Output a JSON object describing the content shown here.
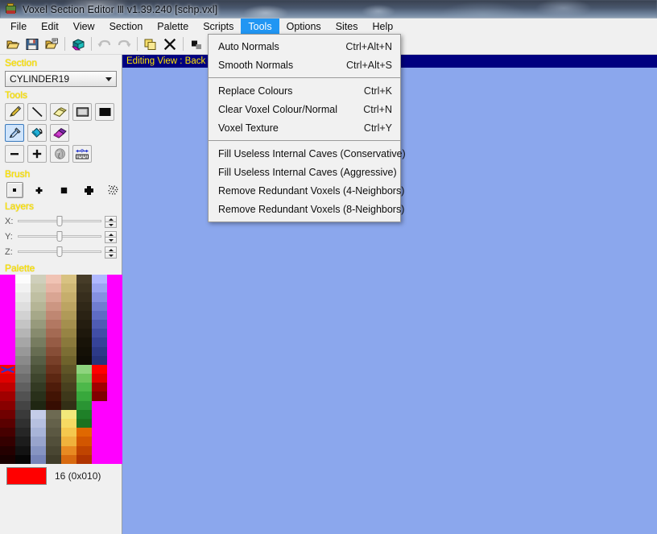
{
  "window": {
    "title": "Voxel Section Editor Ⅲ v1.39.240 [schp.vxl]",
    "icon": "voxel-app-icon"
  },
  "menubar": {
    "items": [
      {
        "label": "File",
        "active": false
      },
      {
        "label": "Edit",
        "active": false
      },
      {
        "label": "View",
        "active": false
      },
      {
        "label": "Section",
        "active": false
      },
      {
        "label": "Palette",
        "active": false
      },
      {
        "label": "Scripts",
        "active": false
      },
      {
        "label": "Tools",
        "active": true
      },
      {
        "label": "Options",
        "active": false
      },
      {
        "label": "Sites",
        "active": false
      },
      {
        "label": "Help",
        "active": false
      }
    ]
  },
  "toolbar": {
    "buttons": [
      {
        "name": "open-icon",
        "tip": "Open"
      },
      {
        "name": "save-icon",
        "tip": "Save"
      },
      {
        "name": "save-as-icon",
        "tip": "Save As"
      },
      {
        "name": "voxel-shape-icon",
        "tip": "Voxel"
      },
      {
        "name": "undo-icon",
        "tip": "Undo",
        "disabled": true
      },
      {
        "name": "redo-icon",
        "tip": "Redo",
        "disabled": true
      },
      {
        "name": "copy-icon",
        "tip": "Copy"
      },
      {
        "name": "delete-icon",
        "tip": "Delete"
      },
      {
        "name": "cube-icon",
        "tip": "Cube"
      }
    ]
  },
  "tools_menu": {
    "open": true,
    "groups": [
      [
        {
          "label": "Auto Normals",
          "accel": "Ctrl+Alt+N"
        },
        {
          "label": "Smooth Normals",
          "accel": "Ctrl+Alt+S"
        }
      ],
      [
        {
          "label": "Replace Colours",
          "accel": "Ctrl+K"
        },
        {
          "label": "Clear Voxel Colour/Normal",
          "accel": "Ctrl+N"
        },
        {
          "label": "Voxel Texture",
          "accel": "Ctrl+Y"
        }
      ],
      [
        {
          "label": "Fill Useless Internal Caves (Conservative)",
          "accel": ""
        },
        {
          "label": "Fill Useless Internal Caves (Aggressive)",
          "accel": ""
        },
        {
          "label": "Remove Redundant Voxels (4-Neighbors)",
          "accel": ""
        },
        {
          "label": "Remove Redundant Voxels (8-Neighbors)",
          "accel": ""
        }
      ]
    ]
  },
  "sidebar": {
    "section": {
      "label": "Section",
      "value": "CYLINDER19"
    },
    "tools": {
      "label": "Tools",
      "items": [
        {
          "name": "pencil-tool-icon",
          "selected": false
        },
        {
          "name": "line-tool-icon",
          "selected": false
        },
        {
          "name": "eraser-tool-icon",
          "selected": false
        },
        {
          "name": "rectangle-outline-tool-icon",
          "selected": false
        },
        {
          "name": "rectangle-filled-tool-icon",
          "selected": false
        },
        {
          "name": "eyedropper-tool-icon",
          "selected": true
        },
        {
          "name": "paint-bucket-tool-icon",
          "selected": false
        },
        {
          "name": "gradient-fill-tool-icon",
          "selected": false
        },
        {
          "name": "decrease-tool-icon",
          "selected": false
        },
        {
          "name": "increase-tool-icon",
          "selected": false
        },
        {
          "name": "smudge-tool-icon",
          "selected": false
        },
        {
          "name": "measure-tool-icon",
          "selected": false
        }
      ]
    },
    "brush": {
      "label": "Brush",
      "items": [
        {
          "name": "brush-dot-icon",
          "selected": true
        },
        {
          "name": "brush-small-plus-icon",
          "selected": false
        },
        {
          "name": "brush-square-icon",
          "selected": false
        },
        {
          "name": "brush-large-plus-icon",
          "selected": false
        },
        {
          "name": "brush-scatter-icon",
          "selected": false
        }
      ]
    },
    "layers": {
      "label": "Layers",
      "axes": [
        {
          "label": "X:",
          "position_pct": 50
        },
        {
          "label": "Y:",
          "position_pct": 50
        },
        {
          "label": "Z:",
          "position_pct": 50
        }
      ]
    },
    "palette": {
      "label": "Palette",
      "selected_index_label": "16 (0x010)",
      "selected_color": "#ff0000",
      "selected_cell": {
        "col": 0,
        "row": 10
      },
      "columns": 8,
      "rows": 21,
      "colors": [
        [
          "#ff00ff",
          "#fcfcfc",
          "#cfcfbb",
          "#f0c3b4",
          "#d8c281",
          "#463c28",
          "#b0b8ff",
          "#ff00ff"
        ],
        [
          "#ff00ff",
          "#f2f2f2",
          "#c8c8ae",
          "#e6b4a4",
          "#cfb876",
          "#3e3522",
          "#9aa4f0",
          "#ff00ff"
        ],
        [
          "#ff00ff",
          "#e8e8e8",
          "#bfbfa2",
          "#d9a593",
          "#c6ae6c",
          "#372e1d",
          "#8590e0",
          "#ff00ff"
        ],
        [
          "#ff00ff",
          "#dedede",
          "#b5b596",
          "#cc9682",
          "#bca462",
          "#302818",
          "#707dd0",
          "#ff00ff"
        ],
        [
          "#ff00ff",
          "#d2d2d2",
          "#a6a889",
          "#bf8772",
          "#b09a58",
          "#2a2214",
          "#5f6cc4",
          "#ff00ff"
        ],
        [
          "#ff00ff",
          "#c4c4c4",
          "#979a7c",
          "#b27862",
          "#a48f4e",
          "#241d10",
          "#4f5cb4",
          "#ff00ff"
        ],
        [
          "#ff00ff",
          "#b5b5b5",
          "#878b6e",
          "#a46a53",
          "#978444",
          "#1e180c",
          "#414ea6",
          "#ff00ff"
        ],
        [
          "#ff00ff",
          "#a6a6a6",
          "#777c60",
          "#965c45",
          "#8a793c",
          "#181308",
          "#364398",
          "#ff00ff"
        ],
        [
          "#ff00ff",
          "#989898",
          "#676d52",
          "#874e37",
          "#7c6e34",
          "#141006",
          "#2d3a88",
          "#ff00ff"
        ],
        [
          "#ff00ff",
          "#8a8a8a",
          "#575e45",
          "#784029",
          "#6f632c",
          "#100d05",
          "#26337c",
          "#ff00ff"
        ],
        [
          "#ff0000",
          "#7c7c7c",
          "#4a5138",
          "#6a331d",
          "#5f5527",
          "#8ed47e",
          "#ff0000",
          "#ff00ff"
        ],
        [
          "#e00000",
          "#6e6e6e",
          "#3e452d",
          "#5c2712",
          "#534a22",
          "#6cc45c",
          "#e00000",
          "#ff00ff"
        ],
        [
          "#c00000",
          "#606060",
          "#333a23",
          "#4e1c0a",
          "#48401e",
          "#4db84a",
          "#a00000",
          "#ff00ff"
        ],
        [
          "#a00000",
          "#525252",
          "#29301a",
          "#421404",
          "#3e381a",
          "#38a83c",
          "#800000",
          "#ff00ff"
        ],
        [
          "#880000",
          "#444444",
          "#1f2612",
          "#360d02",
          "#332f16",
          "#2a9433",
          "#ff00ff",
          "#ff00ff"
        ],
        [
          "#700000",
          "#3a3a3a",
          "#c4cce8",
          "#6d6a52",
          "#f2e87a",
          "#1f8028",
          "#ff00ff",
          "#ff00ff"
        ],
        [
          "#5a0000",
          "#303030",
          "#b6c0e0",
          "#64614a",
          "#f6da63",
          "#1b721f",
          "#ff00ff",
          "#ff00ff"
        ],
        [
          "#460000",
          "#262626",
          "#a8b4d8",
          "#5b5842",
          "#f5c84e",
          "#e06800",
          "#ff00ff",
          "#ff00ff"
        ],
        [
          "#340000",
          "#1c1c1c",
          "#98a4cc",
          "#524f3a",
          "#f0b23c",
          "#d25600",
          "#ff00ff",
          "#ff00ff"
        ],
        [
          "#240000",
          "#121212",
          "#8694c2",
          "#494632",
          "#e88a22",
          "#c04400",
          "#ff00ff",
          "#ff00ff"
        ],
        [
          "#180000",
          "#060606",
          "#7684b8",
          "#403d2a",
          "#d86a10",
          "#b03400",
          "#ff00ff",
          "#ff00ff"
        ]
      ]
    }
  },
  "canvas": {
    "mdi_title": "Editing View : Back",
    "background_color": "#8ba7ed"
  },
  "colors": {
    "menu_highlight": "#2196f3",
    "group_label": "#ffe500",
    "mdi_titlebar": "#000080",
    "panel_bg": "#f0f0f0",
    "canvas_bg": "#8ba7ed"
  }
}
